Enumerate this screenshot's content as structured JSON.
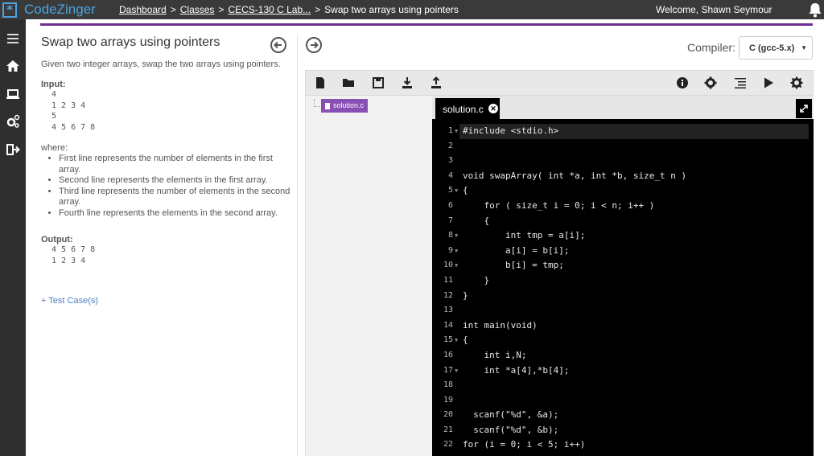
{
  "header": {
    "logo_glyph": "*",
    "brand": "CodeZinger",
    "breadcrumb": [
      {
        "label": "Dashboard",
        "link": true
      },
      {
        "label": ">",
        "link": false
      },
      {
        "label": "Classes",
        "link": true
      },
      {
        "label": ">",
        "link": false
      },
      {
        "label": "CECS-130 C Lab...",
        "link": true
      },
      {
        "label": ">",
        "link": false
      },
      {
        "label": "Swap two arrays using pointers",
        "link": false
      }
    ],
    "welcome": "Welcome, Shawn Seymour"
  },
  "sidebar": {
    "icons": [
      "menu-icon",
      "home-icon",
      "laptop-icon",
      "settings-icon",
      "logout-icon"
    ]
  },
  "problem": {
    "title": "Swap two arrays using pointers",
    "description": "Given two integer arrays, swap the two arrays using pointers.",
    "input_label": "Input:",
    "input_lines": [
      "4",
      "1 2 3 4",
      "5",
      "4 5 6 7 8"
    ],
    "where_label": "where:",
    "rules": [
      "First line represents the number of elements in the first array.",
      "Second line represents the elements in the first array.",
      "Third line represents the number of elements in the second array.",
      "Fourth line represents the elements in the second array."
    ],
    "output_label": "Output:",
    "output_lines": [
      "4 5 6 7 8",
      "1 2 3 4"
    ],
    "test_cases_link": "+ Test Case(s)"
  },
  "compiler": {
    "label": "Compiler:",
    "selected": "C (gcc-5.x)"
  },
  "file_tree": {
    "file": "solution.c"
  },
  "editor": {
    "tab_label": "solution.c",
    "lines": [
      {
        "n": "1",
        "fold": true,
        "text": "#include <stdio.h>",
        "active": true
      },
      {
        "n": "2",
        "fold": false,
        "text": ""
      },
      {
        "n": "3",
        "fold": false,
        "text": ""
      },
      {
        "n": "4",
        "fold": false,
        "text": "void swapArray( int *a, int *b, size_t n )"
      },
      {
        "n": "5",
        "fold": true,
        "text": "{"
      },
      {
        "n": "6",
        "fold": false,
        "text": "    for ( size_t i = 0; i < n; i++ )"
      },
      {
        "n": "7",
        "fold": false,
        "text": "    {"
      },
      {
        "n": "8",
        "fold": true,
        "text": "        int tmp = a[i];"
      },
      {
        "n": "9",
        "fold": true,
        "text": "        a[i] = b[i];"
      },
      {
        "n": "10",
        "fold": true,
        "text": "        b[i] = tmp;"
      },
      {
        "n": "11",
        "fold": false,
        "text": "    }"
      },
      {
        "n": "12",
        "fold": false,
        "text": "}"
      },
      {
        "n": "13",
        "fold": false,
        "text": ""
      },
      {
        "n": "14",
        "fold": false,
        "text": "int main(void)"
      },
      {
        "n": "15",
        "fold": true,
        "text": "{"
      },
      {
        "n": "16",
        "fold": false,
        "text": "    int i,N;"
      },
      {
        "n": "17",
        "fold": true,
        "text": "    int *a[4],*b[4];"
      },
      {
        "n": "18",
        "fold": false,
        "text": ""
      },
      {
        "n": "19",
        "fold": false,
        "text": ""
      },
      {
        "n": "20",
        "fold": false,
        "text": "  scanf(\"%d\", &a);"
      },
      {
        "n": "21",
        "fold": false,
        "text": "  scanf(\"%d\", &b);"
      },
      {
        "n": "22",
        "fold": false,
        "text": "for (i = 0; i < 5; i++)"
      }
    ]
  },
  "colors": {
    "accent": "#6f2c91",
    "brand": "#4aa3df",
    "link": "#4f7fbf"
  }
}
